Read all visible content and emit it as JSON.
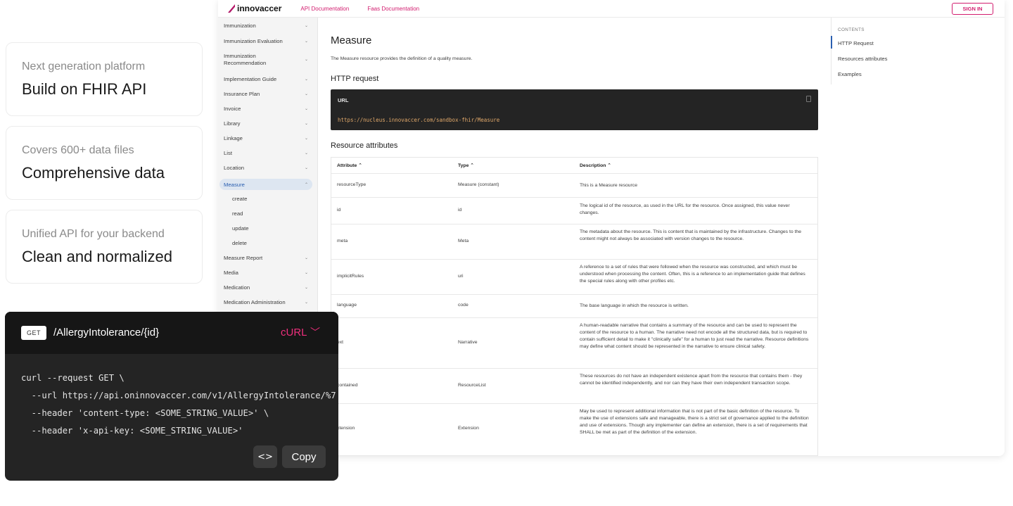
{
  "cards": [
    {
      "sub": "Next generation platform",
      "main": "Build on FHIR API"
    },
    {
      "sub": "Covers 600+ data files",
      "main": "Comprehensive data"
    },
    {
      "sub": "Unified API for your backend",
      "main": "Clean and normalized"
    }
  ],
  "docs": {
    "logo": "innovaccer",
    "links": [
      "API Documentation",
      "Faas Documentation"
    ],
    "signin": "SIGN IN",
    "nav": [
      "Immunization",
      "Immunization Evaluation",
      "Immunization Recommendation",
      "Implementation Guide",
      "Insurance Plan",
      "Invoice",
      "Library",
      "Linkage",
      "List",
      "Location",
      "Measure",
      "Measure Report",
      "Media",
      "Medication",
      "Medication Administration"
    ],
    "nav_sub": [
      "create",
      "read",
      "update",
      "delete"
    ],
    "title": "Measure",
    "description": "The Measure resource provides the definition of a quality measure.",
    "http_heading": "HTTP request",
    "url_label": "URL",
    "url_value": "https://nucleus.innovaccer.com/sandbox-fhir/Measure",
    "resource_heading": "Resource attributes",
    "table_headers": [
      "Attribute ⌃",
      "Type ⌃",
      "Description ⌃"
    ],
    "rows": [
      {
        "attr": "resourceType",
        "type": "Measure (constant)",
        "desc": "This is a Measure resource"
      },
      {
        "attr": "id",
        "type": "id",
        "desc": "The logical id of the resource, as used in the URL for the resource. Once assigned, this value never changes."
      },
      {
        "attr": "meta",
        "type": "Meta",
        "desc": "The metadata about the resource. This is content that is maintained by the infrastructure. Changes to the content might not always be associated with version changes to the resource."
      },
      {
        "attr": "implicitRules",
        "type": "uri",
        "desc": "A reference to a set of rules that were followed when the resource was constructed, and which must be understood when processing the content. Often, this is a reference to an implementation guide that defines the special rules along with other profiles etc."
      },
      {
        "attr": "language",
        "type": "code",
        "desc": "The base language in which the resource is written."
      },
      {
        "attr": "ext",
        "type": "Narrative",
        "desc": "A human-readable narrative that contains a summary of the resource and can be used to represent the content of the resource to a human. The narrative need not encode all the structured data, but is required to contain sufficient detail to make it \"clinically safe\" for a human to just read the narrative. Resource definitions may define what content should be represented in the narrative to ensure clinical safety."
      },
      {
        "attr": "contained",
        "type": "ResourceList",
        "desc": "These resources do not have an independent existence apart from the resource that contains them - they cannot be identified independently, and nor can they have their own independent transaction scope."
      },
      {
        "attr": "xtension",
        "type": "Extension",
        "desc": "May be used to represent additional information that is not part of the basic definition of the resource. To make the use of extensions safe and manageable, there is a strict set of governance applied to the definition and use of extensions. Though any implementer can define an extension, there is a set of requirements that SHALL be met as part of the definition of the extension."
      }
    ],
    "toc_heading": "CONTENTS",
    "toc": [
      "HTTP Request",
      "Resources attributes",
      "Examples"
    ]
  },
  "api": {
    "method": "GET",
    "path": "/AllergyIntolerance/{id}",
    "lang": "cURL",
    "code": "curl --request GET \\\n  --url https://api.oninnovaccer.com/v1/AllergyIntolerance/%7\n  --header 'content-type: <SOME_STRING_VALUE>' \\\n  --header 'x-api-key: <SOME_STRING_VALUE>'",
    "copy": "Copy",
    "code_icon": "<>"
  }
}
